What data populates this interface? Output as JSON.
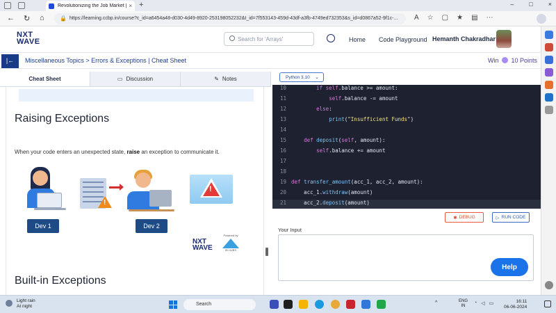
{
  "browser": {
    "tab_title": "Revolutionizing the Job Market |",
    "new_tab_symbol": "+",
    "close_symbol": "×",
    "url": "https://learning.ccbp.in/course?c_id=a6454a48-d030-4d49-8920-253198052232&t_id=7f553143-459d-43df-a3fb-4749ed732353&s_id=d0867a52-9f1c-...",
    "window_controls": [
      "–",
      "□",
      "×"
    ]
  },
  "site": {
    "logo_line1": "NXT",
    "logo_line2": "WAVE",
    "search_placeholder": "Search for 'Arrays'",
    "nav": {
      "home": "Home",
      "code_playground": "Code Playground"
    },
    "username": "Hemanth Chakradhar"
  },
  "breadcrumb": {
    "text": "Miscellaneous Topics > Errors & Exceptions | Cheat Sheet",
    "win_prefix": "Win",
    "points": "10 Points"
  },
  "left_tabs": [
    {
      "label": "Cheat Sheet",
      "icon": ""
    },
    {
      "label": "Discussion",
      "icon": "chat-icon"
    },
    {
      "label": "Notes",
      "icon": "notes-icon"
    }
  ],
  "content": {
    "heading_raising": "Raising Exceptions",
    "para_before": "When your code enters an unexpected state, ",
    "para_bold": "raise",
    "para_after": " an exception to communicate it.",
    "dev1": "Dev 1",
    "dev2": "Dev 2",
    "brand_line1": "NXT",
    "brand_line2": "WAVE",
    "powered_by": "Powered by",
    "ib_hubs": "IB HUBS",
    "heading_builtin": "Built-in Exceptions"
  },
  "editor": {
    "language": "Python 3.10",
    "lines": [
      {
        "n": "10",
        "code": "        if self.balance >= amount:"
      },
      {
        "n": "11",
        "code": "            self.balance -= amount"
      },
      {
        "n": "12",
        "code": "        else:"
      },
      {
        "n": "13",
        "code": "            print(\"Insufficient Funds\")"
      },
      {
        "n": "14",
        "code": ""
      },
      {
        "n": "15",
        "code": "    def deposit(self, amount):"
      },
      {
        "n": "16",
        "code": "        self.balance += amount"
      },
      {
        "n": "17",
        "code": ""
      },
      {
        "n": "18",
        "code": ""
      },
      {
        "n": "19",
        "code": "def transfer_amount(acc_1, acc_2, amount):"
      },
      {
        "n": "20",
        "code": "    acc_1.withdraw(amount)"
      },
      {
        "n": "21",
        "code": "    acc_2.deposit(amount)"
      }
    ],
    "debug_label": "DEBUG",
    "run_label": "RUN CODE",
    "input_label": "Your Input",
    "help_label": "Help"
  },
  "taskbar": {
    "weather_line1": "Light rain",
    "weather_line2": "At night",
    "search": "Search",
    "lang_line1": "ENG",
    "lang_line2": "IN",
    "time": "16:11",
    "date": "06-06-2024"
  },
  "colors": {
    "brand_navy": "#1a2b6b",
    "accent_blue": "#1f4a9a",
    "editor_bg": "#1e2230",
    "help_blue": "#1a73e8",
    "debug_orange": "#e65b3c"
  }
}
